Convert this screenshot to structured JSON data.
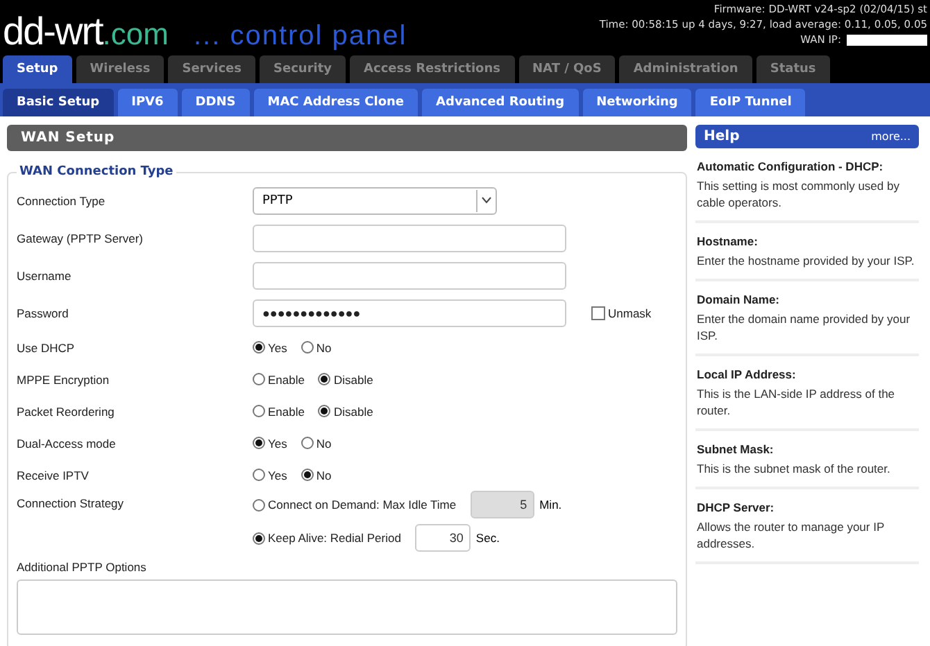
{
  "header": {
    "logo_main": "dd-wrt",
    "logo_domain": ".com",
    "logo_tagline": "... control panel",
    "firmware": "Firmware: DD-WRT v24-sp2 (02/04/15) st",
    "uptime": "Time: 00:58:15 up 4 days, 9:27, load average: 0.11, 0.05, 0.05",
    "wan_ip_label": "WAN IP:"
  },
  "tabs": [
    {
      "label": "Setup",
      "selected": true
    },
    {
      "label": "Wireless",
      "selected": false
    },
    {
      "label": "Services",
      "selected": false
    },
    {
      "label": "Security",
      "selected": false
    },
    {
      "label": "Access Restrictions",
      "selected": false
    },
    {
      "label": "NAT / QoS",
      "selected": false
    },
    {
      "label": "Administration",
      "selected": false
    },
    {
      "label": "Status",
      "selected": false
    }
  ],
  "subtabs": [
    {
      "label": "Basic Setup",
      "selected": true
    },
    {
      "label": "IPV6",
      "selected": false
    },
    {
      "label": "DDNS",
      "selected": false
    },
    {
      "label": "MAC Address Clone",
      "selected": false
    },
    {
      "label": "Advanced Routing",
      "selected": false
    },
    {
      "label": "Networking",
      "selected": false
    },
    {
      "label": "EoIP Tunnel",
      "selected": false
    }
  ],
  "section_title": "WAN Setup",
  "fieldset_legend": "WAN Connection Type",
  "fields": [
    {
      "kind": "select",
      "label": "Connection Type",
      "value": "PPTP"
    },
    {
      "kind": "text",
      "label": "Gateway (PPTP Server)"
    },
    {
      "kind": "text",
      "label": "Username"
    },
    {
      "kind": "password",
      "label": "Password",
      "value": "●●●●●●●●●●●●●",
      "unmask_label": "Unmask",
      "unmask_checked": false
    },
    {
      "kind": "radio",
      "label": "Use DHCP",
      "options": [
        {
          "label": "Yes",
          "selected": true
        },
        {
          "label": "No",
          "selected": false
        }
      ]
    },
    {
      "kind": "radio",
      "label": "MPPE Encryption",
      "options": [
        {
          "label": "Enable",
          "selected": false
        },
        {
          "label": "Disable",
          "selected": true
        }
      ]
    },
    {
      "kind": "radio",
      "label": "Packet Reordering",
      "options": [
        {
          "label": "Enable",
          "selected": false
        },
        {
          "label": "Disable",
          "selected": true
        }
      ]
    },
    {
      "kind": "radio",
      "label": "Dual-Access mode",
      "options": [
        {
          "label": "Yes",
          "selected": true
        },
        {
          "label": "No",
          "selected": false
        }
      ]
    },
    {
      "kind": "radio",
      "label": "Receive IPTV",
      "options": [
        {
          "label": "Yes",
          "selected": false
        },
        {
          "label": "No",
          "selected": true
        }
      ]
    },
    {
      "kind": "strategy",
      "label": "Connection Strategy",
      "options": [
        {
          "label": "Connect on Demand: Max Idle Time",
          "selected": false,
          "value": "5",
          "unit": "Min.",
          "disabled": true
        },
        {
          "label": "Keep Alive: Redial Period",
          "selected": true,
          "value": "30",
          "unit": "Sec.",
          "disabled": false
        }
      ]
    }
  ],
  "additional_options_label": "Additional PPTP Options",
  "help": {
    "title": "Help",
    "more": "more...",
    "entries": [
      {
        "title": "Automatic Configuration - DHCP:",
        "text": "This setting is most commonly used by cable operators."
      },
      {
        "title": "Hostname:",
        "text": "Enter the hostname provided by your ISP."
      },
      {
        "title": "Domain Name:",
        "text": "Enter the domain name provided by your ISP."
      },
      {
        "title": "Local IP Address:",
        "text": "This is the LAN-side IP address of the router."
      },
      {
        "title": "Subnet Mask:",
        "text": "This is the subnet mask of the router."
      },
      {
        "title": "DHCP Server:",
        "text": "Allows the router to manage your IP addresses."
      }
    ]
  }
}
